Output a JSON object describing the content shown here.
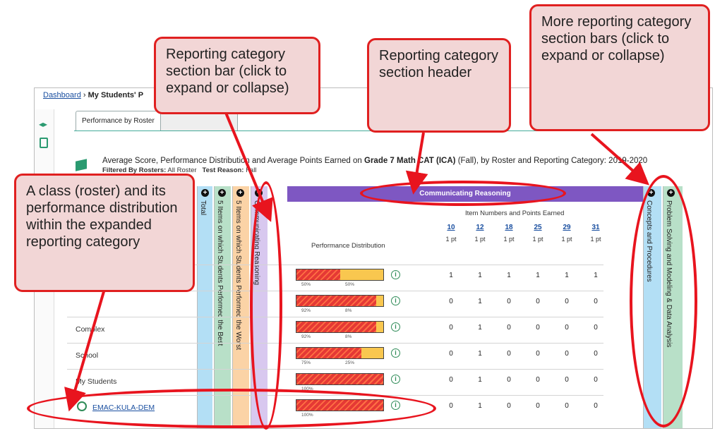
{
  "breadcrumb": {
    "home": "Dashboard",
    "sep": "›",
    "current": "My Students' P"
  },
  "tabs": {
    "active": "Performance by Roster"
  },
  "report": {
    "title_prefix": "Average Score, Performance Distribution and Average Points Earned on ",
    "title_bold": "Grade 7 Math CAT (ICA)",
    "title_suffix": " (Fall), by Roster and Reporting Category: 2019-2020",
    "filter_label": "Filtered By Rosters:",
    "filter_value": "All Roster",
    "reason_label": "Test Reason:",
    "reason_value": "Fall"
  },
  "columns": {
    "total": "Total",
    "best": "5 Items on which Students Performed the Best",
    "worst": "5 Items on which Students Performed the Worst",
    "communicating": "Communicating Reasoning",
    "concepts": "Concepts and Procedures",
    "problem": "Problem Solving and Modeling & Data Analysis"
  },
  "section": {
    "header": "Communicating Reasoning",
    "perf_head": "Performance Distribution",
    "items_head": "Item Numbers and Points Earned",
    "items": [
      {
        "num": "10",
        "pt": "1 pt"
      },
      {
        "num": "12",
        "pt": "1 pt"
      },
      {
        "num": "18",
        "pt": "1 pt"
      },
      {
        "num": "25",
        "pt": "1 pt"
      },
      {
        "num": "29",
        "pt": "1 pt"
      },
      {
        "num": "31",
        "pt": "1 pt"
      }
    ]
  },
  "rows": [
    {
      "label": "",
      "red_pct": 50,
      "red_label": "50%",
      "yel_label": "50%",
      "vals": [
        "1",
        "1",
        "1",
        "1",
        "1",
        "1"
      ]
    },
    {
      "label": "",
      "red_pct": 92,
      "red_label": "92%",
      "yel_label": "8%",
      "vals": [
        "0",
        "1",
        "0",
        "0",
        "0",
        "0"
      ]
    },
    {
      "label": "Complex",
      "red_pct": 92,
      "red_label": "92%",
      "yel_label": "8%",
      "vals": [
        "0",
        "1",
        "0",
        "0",
        "0",
        "0"
      ]
    },
    {
      "label": "School",
      "red_pct": 75,
      "red_label": "75%",
      "yel_label": "25%",
      "vals": [
        "0",
        "1",
        "0",
        "0",
        "0",
        "0"
      ]
    },
    {
      "label": "My Students",
      "red_pct": 100,
      "red_label": "100%",
      "yel_label": "",
      "vals": [
        "0",
        "1",
        "0",
        "0",
        "0",
        "0"
      ]
    },
    {
      "label": "EMAC-KULA-DEM",
      "red_pct": 100,
      "red_label": "100%",
      "yel_label": "",
      "vals": [
        "0",
        "1",
        "0",
        "0",
        "0",
        "0"
      ]
    }
  ],
  "callouts": {
    "section_bar": "Reporting category section bar (click to expand or collapse)",
    "section_header": "Reporting category section header",
    "more_bars": "More reporting category section bars (click to expand or collapse)",
    "class_roster": "A class (roster) and its performance distribution within the expanded reporting category"
  },
  "colors": {
    "annotation_red": "#e02020",
    "callout_fill": "#f2d6d6",
    "section_purple": "#7e57c2"
  }
}
